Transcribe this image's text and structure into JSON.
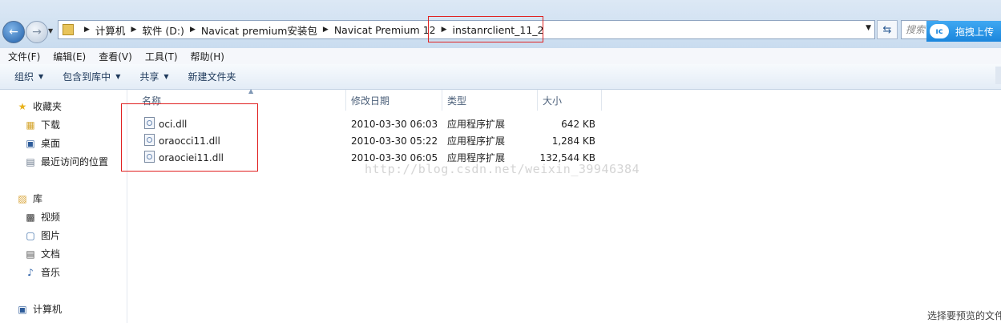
{
  "address": {
    "crumbs": [
      "计算机",
      "软件 (D:)",
      "Navicat premium安装包",
      "Navicat Premium 12",
      "instanrclient_11_2"
    ],
    "search_placeholder": "搜索",
    "upload_label": "拖拽上传",
    "upload_logo": "ıc"
  },
  "menu": [
    "文件(F)",
    "编辑(E)",
    "查看(V)",
    "工具(T)",
    "帮助(H)"
  ],
  "toolbar": {
    "organize": "组织",
    "include_library": "包含到库中",
    "share": "共享",
    "new_folder": "新建文件夹"
  },
  "nav": {
    "favorites": "收藏夹",
    "downloads": "下载",
    "desktop": "桌面",
    "recent": "最近访问的位置",
    "libraries": "库",
    "videos": "视频",
    "pictures": "图片",
    "documents": "文档",
    "music": "音乐",
    "computer": "计算机"
  },
  "columns": {
    "name": "名称",
    "modified": "修改日期",
    "type": "类型",
    "size": "大小"
  },
  "files": [
    {
      "name": "oci.dll",
      "modified": "2010-03-30 06:03",
      "type": "应用程序扩展",
      "size": "642 KB"
    },
    {
      "name": "oraocci11.dll",
      "modified": "2010-03-30 05:22",
      "type": "应用程序扩展",
      "size": "1,284 KB"
    },
    {
      "name": "oraociei11.dll",
      "modified": "2010-03-30 06:05",
      "type": "应用程序扩展",
      "size": "132,544 KB"
    }
  ],
  "watermark": "http://blog.csdn.net/weixin_39946384",
  "status_hint": "选择要预览的文件",
  "colors": {
    "highlight_box": "#e02020",
    "upload_bg": "#1b86dc"
  },
  "icons": [
    "back-arrow-icon",
    "forward-arrow-icon",
    "folder-icon",
    "refresh-icon",
    "star-icon",
    "dll-file-icon"
  ]
}
